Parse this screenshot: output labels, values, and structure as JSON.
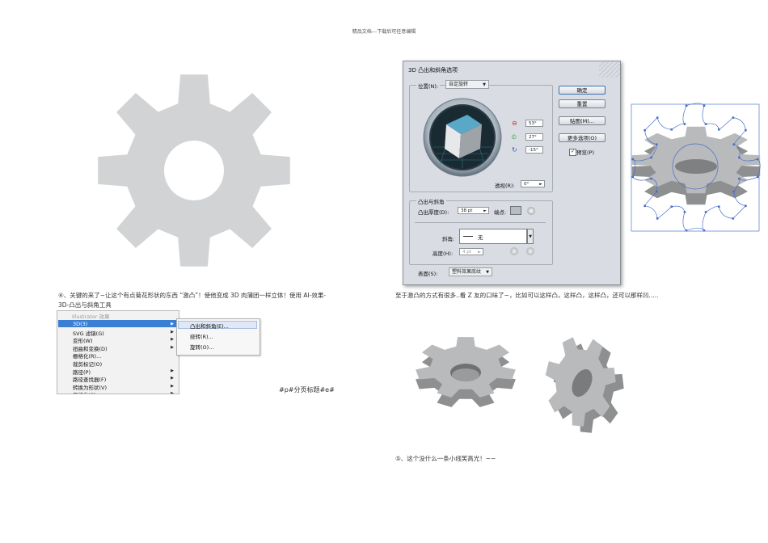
{
  "header": {
    "text": "精品文档---下载后可任意编辑"
  },
  "left_caption": {
    "line1": "④、关键的来了~让这个有点菊花形状的东西 “激凸”！使他变成 3D 肉蒲团一样立体！使用 AI-效果-",
    "line2": "3D-凸出与斜角工具"
  },
  "right_caption": "至于激凸的方式有很多..看 Z 友的口味了~，比如可以这样凸，这样凸，这样凸，还可以那样凹.....",
  "bottom_caption": "⑤、这个没什么一条小线笑高光！~~",
  "page_marker": "#p#分页标题#e#",
  "menu": {
    "header": "Illustrator 效果",
    "items": [
      "3D(3)",
      "SVG 滤镜(G)",
      "变形(W)",
      "扭曲和变换(D)",
      "栅格化(R)...",
      "裁剪标记(O)",
      "路径(P)",
      "路径查找器(F)",
      "转换为形状(V)",
      "风格化(S)"
    ],
    "arrow_flags": [
      true,
      true,
      true,
      true,
      false,
      false,
      true,
      true,
      true,
      true
    ],
    "submenu": [
      "凸出和斜角(E)...",
      "绕转(R)...",
      "旋转(O)..."
    ]
  },
  "dialog": {
    "title": "3D 凸出和斜角选项",
    "position_label": "位置(N):",
    "position_value": "自定旋转",
    "rot_x": "53°",
    "rot_y": "27°",
    "rot_z": "-15°",
    "perspective_label": "透视(R):",
    "perspective_value": "0°",
    "extrude_group": "凸出与斜角",
    "extrude_depth_label": "凸出厚度(D):",
    "extrude_depth_value": "38 pt",
    "cap_label": "端点:",
    "bevel_label": "斜角:",
    "bevel_value": "无",
    "height_label": "高度(H):",
    "height_value": "4 pt",
    "surface_label": "表面(S):",
    "surface_value": "塑料效果底纹",
    "buttons": {
      "ok": "确定",
      "reset": "重置",
      "map": "贴图(M)...",
      "more": "更多选项(O)",
      "preview": "预览(P)"
    }
  },
  "colors": {
    "gear_flat": "#d2d3d4",
    "gear_top": "#b9babb",
    "gear_side": "#8e8f90",
    "cube_top": "#5aa8c8",
    "dialog_bg": "#d9dde3",
    "menu_highlight": "#3b7fd4"
  }
}
